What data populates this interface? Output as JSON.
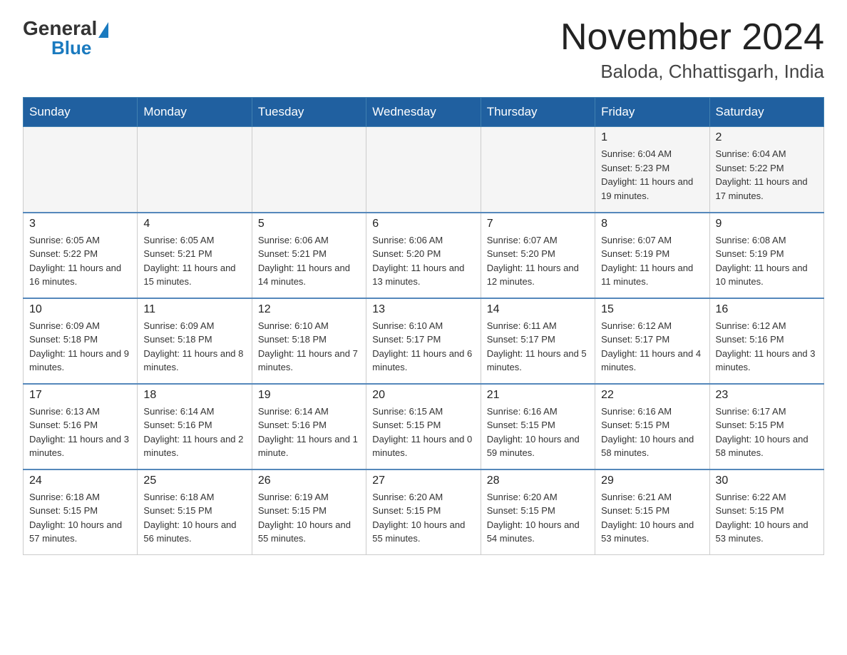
{
  "logo": {
    "general": "General",
    "blue": "Blue"
  },
  "header": {
    "month": "November 2024",
    "location": "Baloda, Chhattisgarh, India"
  },
  "weekdays": [
    "Sunday",
    "Monday",
    "Tuesday",
    "Wednesday",
    "Thursday",
    "Friday",
    "Saturday"
  ],
  "weeks": [
    [
      {
        "day": "",
        "info": ""
      },
      {
        "day": "",
        "info": ""
      },
      {
        "day": "",
        "info": ""
      },
      {
        "day": "",
        "info": ""
      },
      {
        "day": "",
        "info": ""
      },
      {
        "day": "1",
        "info": "Sunrise: 6:04 AM\nSunset: 5:23 PM\nDaylight: 11 hours and 19 minutes."
      },
      {
        "day": "2",
        "info": "Sunrise: 6:04 AM\nSunset: 5:22 PM\nDaylight: 11 hours and 17 minutes."
      }
    ],
    [
      {
        "day": "3",
        "info": "Sunrise: 6:05 AM\nSunset: 5:22 PM\nDaylight: 11 hours and 16 minutes."
      },
      {
        "day": "4",
        "info": "Sunrise: 6:05 AM\nSunset: 5:21 PM\nDaylight: 11 hours and 15 minutes."
      },
      {
        "day": "5",
        "info": "Sunrise: 6:06 AM\nSunset: 5:21 PM\nDaylight: 11 hours and 14 minutes."
      },
      {
        "day": "6",
        "info": "Sunrise: 6:06 AM\nSunset: 5:20 PM\nDaylight: 11 hours and 13 minutes."
      },
      {
        "day": "7",
        "info": "Sunrise: 6:07 AM\nSunset: 5:20 PM\nDaylight: 11 hours and 12 minutes."
      },
      {
        "day": "8",
        "info": "Sunrise: 6:07 AM\nSunset: 5:19 PM\nDaylight: 11 hours and 11 minutes."
      },
      {
        "day": "9",
        "info": "Sunrise: 6:08 AM\nSunset: 5:19 PM\nDaylight: 11 hours and 10 minutes."
      }
    ],
    [
      {
        "day": "10",
        "info": "Sunrise: 6:09 AM\nSunset: 5:18 PM\nDaylight: 11 hours and 9 minutes."
      },
      {
        "day": "11",
        "info": "Sunrise: 6:09 AM\nSunset: 5:18 PM\nDaylight: 11 hours and 8 minutes."
      },
      {
        "day": "12",
        "info": "Sunrise: 6:10 AM\nSunset: 5:18 PM\nDaylight: 11 hours and 7 minutes."
      },
      {
        "day": "13",
        "info": "Sunrise: 6:10 AM\nSunset: 5:17 PM\nDaylight: 11 hours and 6 minutes."
      },
      {
        "day": "14",
        "info": "Sunrise: 6:11 AM\nSunset: 5:17 PM\nDaylight: 11 hours and 5 minutes."
      },
      {
        "day": "15",
        "info": "Sunrise: 6:12 AM\nSunset: 5:17 PM\nDaylight: 11 hours and 4 minutes."
      },
      {
        "day": "16",
        "info": "Sunrise: 6:12 AM\nSunset: 5:16 PM\nDaylight: 11 hours and 3 minutes."
      }
    ],
    [
      {
        "day": "17",
        "info": "Sunrise: 6:13 AM\nSunset: 5:16 PM\nDaylight: 11 hours and 3 minutes."
      },
      {
        "day": "18",
        "info": "Sunrise: 6:14 AM\nSunset: 5:16 PM\nDaylight: 11 hours and 2 minutes."
      },
      {
        "day": "19",
        "info": "Sunrise: 6:14 AM\nSunset: 5:16 PM\nDaylight: 11 hours and 1 minute."
      },
      {
        "day": "20",
        "info": "Sunrise: 6:15 AM\nSunset: 5:15 PM\nDaylight: 11 hours and 0 minutes."
      },
      {
        "day": "21",
        "info": "Sunrise: 6:16 AM\nSunset: 5:15 PM\nDaylight: 10 hours and 59 minutes."
      },
      {
        "day": "22",
        "info": "Sunrise: 6:16 AM\nSunset: 5:15 PM\nDaylight: 10 hours and 58 minutes."
      },
      {
        "day": "23",
        "info": "Sunrise: 6:17 AM\nSunset: 5:15 PM\nDaylight: 10 hours and 58 minutes."
      }
    ],
    [
      {
        "day": "24",
        "info": "Sunrise: 6:18 AM\nSunset: 5:15 PM\nDaylight: 10 hours and 57 minutes."
      },
      {
        "day": "25",
        "info": "Sunrise: 6:18 AM\nSunset: 5:15 PM\nDaylight: 10 hours and 56 minutes."
      },
      {
        "day": "26",
        "info": "Sunrise: 6:19 AM\nSunset: 5:15 PM\nDaylight: 10 hours and 55 minutes."
      },
      {
        "day": "27",
        "info": "Sunrise: 6:20 AM\nSunset: 5:15 PM\nDaylight: 10 hours and 55 minutes."
      },
      {
        "day": "28",
        "info": "Sunrise: 6:20 AM\nSunset: 5:15 PM\nDaylight: 10 hours and 54 minutes."
      },
      {
        "day": "29",
        "info": "Sunrise: 6:21 AM\nSunset: 5:15 PM\nDaylight: 10 hours and 53 minutes."
      },
      {
        "day": "30",
        "info": "Sunrise: 6:22 AM\nSunset: 5:15 PM\nDaylight: 10 hours and 53 minutes."
      }
    ]
  ]
}
